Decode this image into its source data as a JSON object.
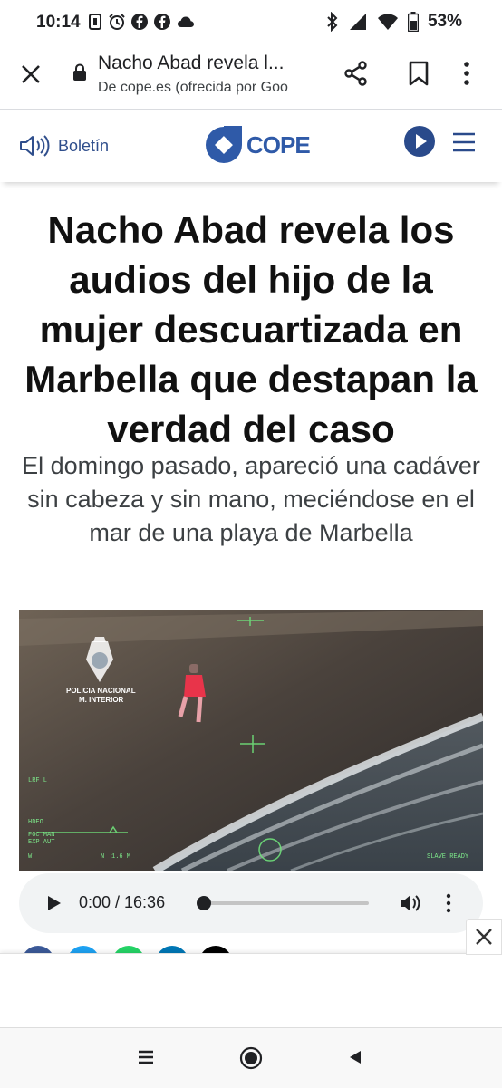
{
  "status": {
    "time": "10:14",
    "battery": "53%",
    "left_icons": [
      "sim-icon",
      "alarm-icon",
      "facebook-icon",
      "facebook-icon",
      "cloud-icon"
    ],
    "right_icons": [
      "bluetooth-icon",
      "signal-icon",
      "wifi-icon",
      "battery-icon"
    ]
  },
  "toolbar": {
    "title": "Nacho Abad revela l...",
    "subtitle": "De cope.es (ofrecida por Goo",
    "icons": [
      "close-icon",
      "lock-icon",
      "share-icon",
      "bookmark-icon",
      "more-vert-icon"
    ]
  },
  "site": {
    "boletin_label": "Boletín",
    "logo_text": "COPE",
    "brand_color": "#2f5aa8"
  },
  "article": {
    "headline": "Nacho Abad revela los audios del hijo de la mujer descuartizada en Marbella que destapan la verdad del caso",
    "subtitle": "El domingo pasado, apareció una cadáver sin cabeza y sin mano, meciéndose en el mar de una playa de Marbella"
  },
  "video": {
    "overlay": {
      "police_line1": "POLICIA NACIONAL",
      "police_line2": "M. INTERIOR",
      "lrf": "LRF L",
      "hdeo": "HDEO",
      "foc": "FOC MAN",
      "exp": "EXP AUT",
      "w": "W",
      "n": "N",
      "range": "1.6 M",
      "slave": "SLAVE READY"
    }
  },
  "audio": {
    "time": "0:00 / 16:36",
    "progress": 0
  },
  "nav": {
    "icons": [
      "menu-icon",
      "home-icon",
      "back-icon"
    ]
  }
}
